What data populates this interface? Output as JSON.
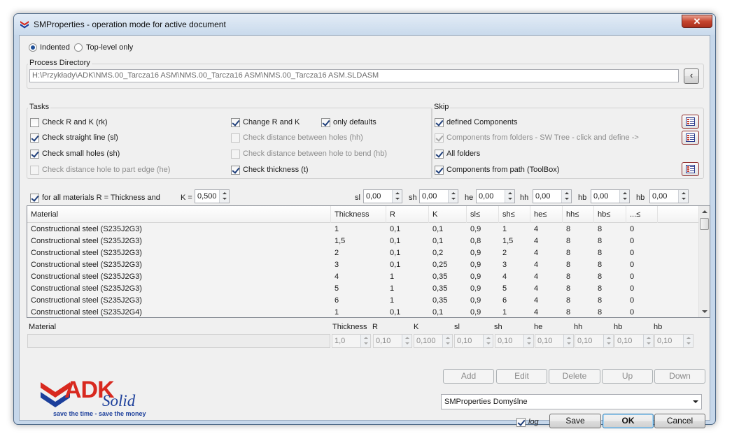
{
  "window": {
    "title": "SMProperties - operation mode for active document",
    "close": "✕"
  },
  "mode": {
    "indented": "Indented",
    "top_level": "Top-level only"
  },
  "process_directory": {
    "label": "Process Directory",
    "path": "H:\\Przykłady\\ADK\\NMS.00_Tarcza16 ASM\\NMS.00_Tarcza16 ASM\\NMS.00_Tarcza16 ASM.SLDASM",
    "browse": "‹"
  },
  "tasks": {
    "title": "Tasks",
    "check_rk": "Check R and K (rk)",
    "check_straight": "Check straight line (sl)",
    "check_small_holes": "Check small holes (sh)",
    "check_hole_edge": "Check distance hole to part edge (he)",
    "change_rk": "Change R and K",
    "only_defaults": "only defaults",
    "check_hh": "Check distance between holes (hh)",
    "check_hb": "Check distance between hole to bend (hb)",
    "check_thickness": "Check thickness (t)"
  },
  "skip": {
    "title": "Skip",
    "defined_components": "defined Components",
    "components_folders": "Components from folders - SW Tree - click and define ->",
    "all_folders": "All folders",
    "components_path": "Components from path (ToolBox)"
  },
  "materials_row": {
    "all_materials": "for all materials R = Thickness and",
    "k_label": "K =",
    "k_value": "0,500",
    "sl_label": "sl",
    "sl_value": "0,00",
    "sh_label": "sh",
    "sh_value": "0,00",
    "he_label": "he",
    "he_value": "0,00",
    "hh_label": "hh",
    "hh_value": "0,00",
    "hb_label": "hb",
    "hb_value": "0,00",
    "hb2_label": "hb",
    "hb2_value": "0,00"
  },
  "grid": {
    "headers": [
      "Material",
      "Thickness",
      "R",
      "K",
      "sl≤",
      "sh≤",
      "he≤",
      "hh≤",
      "hb≤",
      "...≤"
    ],
    "rows": [
      [
        "Constructional steel (S235J2G3)",
        "1",
        "0,1",
        "0,1",
        "0,9",
        "1",
        "4",
        "8",
        "8",
        "0"
      ],
      [
        "Constructional steel (S235J2G3)",
        "1,5",
        "0,1",
        "0,1",
        "0,8",
        "1,5",
        "4",
        "8",
        "8",
        "0"
      ],
      [
        "Constructional steel (S235J2G3)",
        "2",
        "0,1",
        "0,2",
        "0,9",
        "2",
        "4",
        "8",
        "8",
        "0"
      ],
      [
        "Constructional steel (S235J2G3)",
        "3",
        "0,1",
        "0,25",
        "0,9",
        "3",
        "4",
        "8",
        "8",
        "0"
      ],
      [
        "Constructional steel (S235J2G3)",
        "4",
        "1",
        "0,35",
        "0,9",
        "4",
        "4",
        "8",
        "8",
        "0"
      ],
      [
        "Constructional steel (S235J2G3)",
        "5",
        "1",
        "0,35",
        "0,9",
        "5",
        "4",
        "8",
        "8",
        "0"
      ],
      [
        "Constructional steel (S235J2G3)",
        "6",
        "1",
        "0,35",
        "0,9",
        "6",
        "4",
        "8",
        "8",
        "0"
      ],
      [
        "Constructional steel (S235J2G4)",
        "1",
        "0,1",
        "0,1",
        "0,9",
        "1",
        "4",
        "8",
        "8",
        "0"
      ]
    ]
  },
  "editor": {
    "material_label": "Material",
    "thickness_label": "Thickness",
    "thickness_value": "1,0",
    "r_label": "R",
    "r_value": "0,10",
    "k_label": "K",
    "k_value": "0,100",
    "sl_label": "sl",
    "sl_value": "0,10",
    "sh_label": "sh",
    "sh_value": "0,10",
    "he_label": "he",
    "he_value": "0,10",
    "hh_label": "hh",
    "hh_value": "0,10",
    "hb_label": "hb",
    "hb_value": "0,10",
    "hb2_label": "hb",
    "hb2_value": "0,10"
  },
  "buttons": {
    "add": "Add",
    "edit": "Edit",
    "delete": "Delete",
    "up": "Up",
    "down": "Down",
    "save": "Save",
    "ok": "OK",
    "cancel": "Cancel"
  },
  "profile": {
    "selected": "SMProperties Domyślne"
  },
  "log_label": "log",
  "logo": {
    "brand": "ADK",
    "product": "Solid",
    "tagline": "save the time - save the money"
  }
}
